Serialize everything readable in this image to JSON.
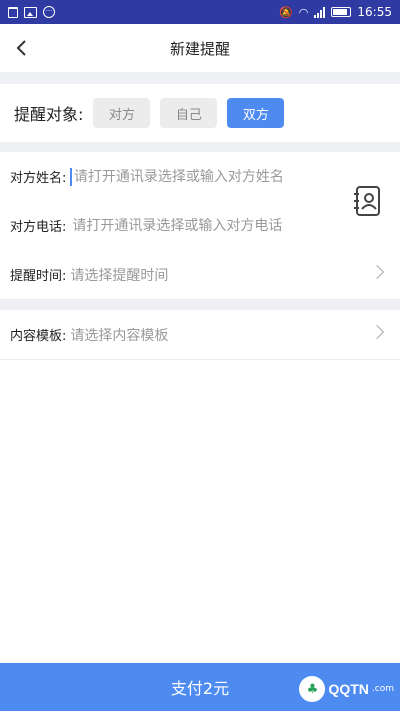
{
  "status_bar": {
    "time": "16:55",
    "icons": [
      "trash-icon",
      "image-icon",
      "message-icon",
      "mute-icon",
      "wifi-icon",
      "signal-icon",
      "battery-icon"
    ]
  },
  "header": {
    "title": "新建提醒",
    "back_icon": "chevron-left-icon"
  },
  "target": {
    "label": "提醒对象:",
    "options": [
      "对方",
      "自己",
      "双方"
    ],
    "selected": "双方"
  },
  "form": {
    "name": {
      "label": "对方姓名:",
      "placeholder": "请打开通讯录选择或输入对方姓名"
    },
    "phone": {
      "label": "对方电话:",
      "placeholder": "请打开通讯录选择或输入对方电话"
    },
    "time": {
      "label": "提醒时间:",
      "placeholder": "请选择提醒时间"
    },
    "template": {
      "label": "内容模板:",
      "placeholder": "请选择内容模板"
    },
    "contact_icon": "contact-book-icon"
  },
  "footer": {
    "pay_label": "支付2元"
  },
  "watermark": {
    "text": "QQTN",
    "suffix": ".com"
  },
  "colors": {
    "status_bar": "#2f3aa3",
    "accent": "#4e8bf1",
    "band": "#eef0f3"
  }
}
